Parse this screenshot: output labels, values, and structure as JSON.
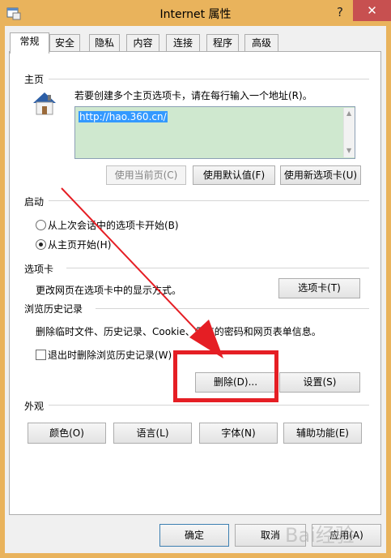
{
  "window": {
    "title": "Internet 属性",
    "help_label": "?",
    "close_label": "✕"
  },
  "tabs": [
    {
      "label": "常规"
    },
    {
      "label": "安全"
    },
    {
      "label": "隐私"
    },
    {
      "label": "内容"
    },
    {
      "label": "连接"
    },
    {
      "label": "程序"
    },
    {
      "label": "高级"
    }
  ],
  "home": {
    "heading": "主页",
    "description": "若要创建多个主页选项卡，请在每行输入一个地址(R)。",
    "url": "http://hao.360.cn/",
    "use_current": "使用当前页(C)",
    "use_default": "使用默认值(F)",
    "use_new_tab": "使用新选项卡(U)"
  },
  "startup": {
    "heading": "启动",
    "option_last_session": "从上次会话中的选项卡开始(B)",
    "option_home": "从主页开始(H)"
  },
  "tabs_section": {
    "heading": "选项卡",
    "description": "更改网页在选项卡中的显示方式。",
    "button": "选项卡(T)"
  },
  "history": {
    "heading": "浏览历史记录",
    "description": "删除临时文件、历史记录、Cookie、保存的密码和网页表单信息。",
    "checkbox_label": "退出时删除浏览历史记录(W)",
    "delete_button": "删除(D)...",
    "settings_button": "设置(S)"
  },
  "appearance": {
    "heading": "外观",
    "colors": "颜色(O)",
    "languages": "语言(L)",
    "fonts": "字体(N)",
    "accessibility": "辅助功能(E)"
  },
  "footer": {
    "ok": "确定",
    "cancel": "取消",
    "apply": "应用(A)"
  },
  "watermark": "Bai经验",
  "colors": {
    "title_bar": "#e9b35c",
    "close": "#c75050",
    "annotation_red": "#e51e24",
    "selection": "#3399ff",
    "url_bg": "#cfe8cf"
  },
  "state": {
    "startup_selected": "home",
    "delete_on_exit": false
  }
}
